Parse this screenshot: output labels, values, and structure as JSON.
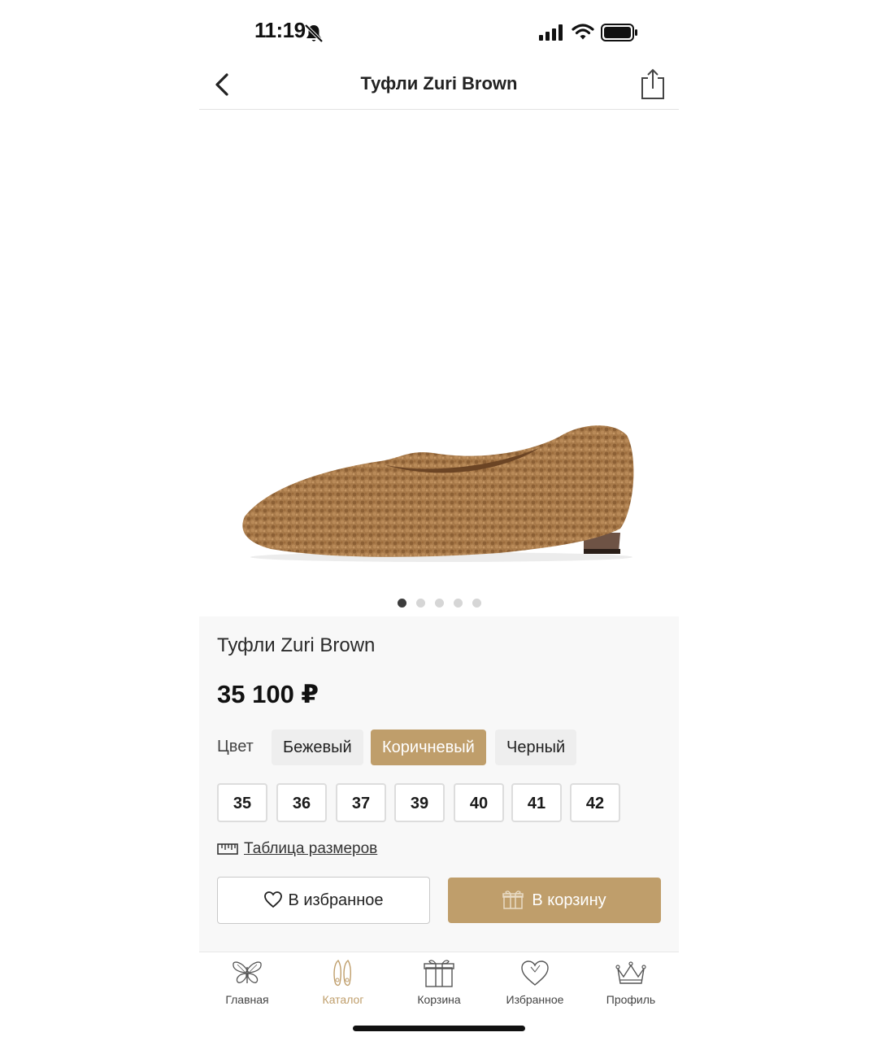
{
  "status_bar": {
    "time": "11:19"
  },
  "nav": {
    "title": "Туфли Zuri Brown"
  },
  "gallery": {
    "total_images": 5,
    "active_index": 0
  },
  "product": {
    "name": "Туфли Zuri Brown",
    "price": "35 100 ₽",
    "color_label": "Цвет",
    "colors": [
      {
        "label": "Бежевый",
        "selected": false
      },
      {
        "label": "Коричневый",
        "selected": true
      },
      {
        "label": "Черный",
        "selected": false
      }
    ],
    "sizes": [
      "35",
      "36",
      "37",
      "39",
      "40",
      "41",
      "42"
    ],
    "size_table_label": "Таблица размеров",
    "favorite_button": "В избранное",
    "cart_button": "В корзину"
  },
  "tab_bar": {
    "items": [
      {
        "label": "Главная",
        "icon": "butterfly-icon",
        "active": false
      },
      {
        "label": "Каталог",
        "icon": "shoes-icon",
        "active": true
      },
      {
        "label": "Корзина",
        "icon": "gift-icon",
        "active": false
      },
      {
        "label": "Избранное",
        "icon": "heart-icon",
        "active": false
      },
      {
        "label": "Профиль",
        "icon": "crown-icon",
        "active": false
      }
    ]
  },
  "colors": {
    "accent": "#bf9e6b",
    "panel_bg": "#f8f8f8",
    "chip_bg": "#eeeeee"
  }
}
